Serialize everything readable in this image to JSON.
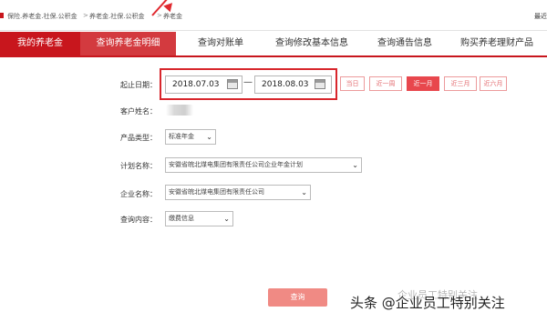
{
  "breadcrumb": {
    "items": [
      "保险.养老金.社保.公积金",
      "养老金.社保.公积金",
      "养老金"
    ],
    "separator": ">",
    "right_text": "最近"
  },
  "tabs": [
    {
      "label": "我的养老金",
      "state": "red"
    },
    {
      "label": "查询养老金明细",
      "state": "active"
    },
    {
      "label": "查询对账单",
      "state": "normal"
    },
    {
      "label": "查询修改基本信息",
      "state": "normal"
    },
    {
      "label": "查询通告信息",
      "state": "normal"
    },
    {
      "label": "购买养老理财产品",
      "state": "normal"
    }
  ],
  "form": {
    "date_label": "起止日期：",
    "start_date": "2018.07.03",
    "end_date": "2018.08.03",
    "range_dash": "—",
    "quick_buttons": [
      {
        "label": "当日",
        "active": false
      },
      {
        "label": "近一周",
        "active": false
      },
      {
        "label": "近一月",
        "active": true
      },
      {
        "label": "近三月",
        "active": false
      },
      {
        "label": "近六月",
        "active": false
      }
    ],
    "customer_label": "客户姓名：",
    "product_label": "产品类型：",
    "product_value": "标准年金",
    "plan_label": "计划名称：",
    "plan_value": "安徽省皖北煤电集团有限责任公司企业年金计划",
    "company_label": "企业名称：",
    "company_value": "安徽省皖北煤电集团有限责任公司",
    "content_label": "查询内容：",
    "content_value": "缴费信息"
  },
  "query_button": "查询",
  "watermark": {
    "main": "头条 @企业员工特别关注",
    "sub": "企业员工特别关注"
  },
  "colors": {
    "brand_red": "#c8161d",
    "active_tab": "#d33a3f",
    "highlight": "#d8262c",
    "query_button": "#f08a84"
  }
}
